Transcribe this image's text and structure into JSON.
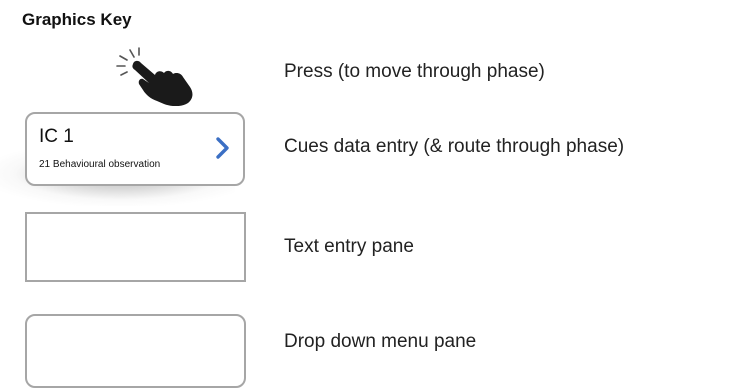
{
  "title": "Graphics Key",
  "colors": {
    "chevron": "#3b6fc4",
    "pane_border": "#a6a6a6",
    "hand": "#1a1a1a"
  },
  "items": [
    {
      "icon": "pointing-hand-icon",
      "label": "Press (to move through phase)"
    },
    {
      "card_title": "IC 1",
      "card_subtitle": "21 Behavioural observation",
      "icon": "chevron-right-icon",
      "label": "Cues data entry (& route through phase)"
    },
    {
      "label": "Text entry pane"
    },
    {
      "label": "Drop down menu pane"
    }
  ]
}
